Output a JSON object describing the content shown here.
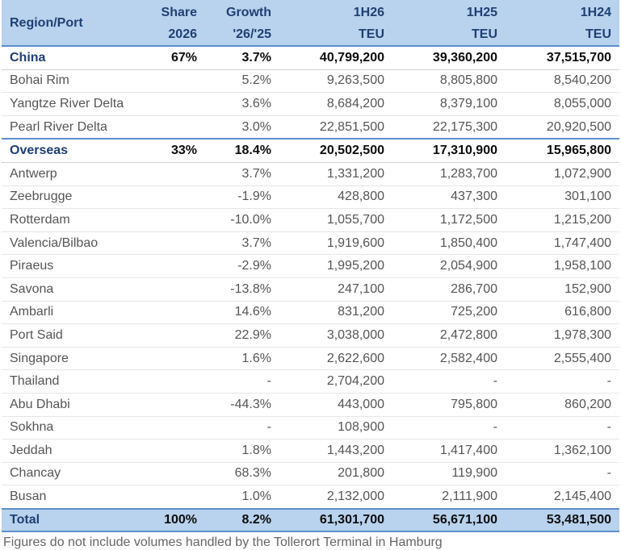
{
  "table": {
    "headers_row1": [
      "Region/Port",
      "Share",
      "Growth",
      "1H26",
      "1H25",
      "1H24"
    ],
    "headers_row2": [
      "",
      "2026",
      "'26/'25",
      "TEU",
      "TEU",
      "TEU"
    ],
    "rows": [
      {
        "kind": "group",
        "cells": [
          "China",
          "67%",
          "3.7%",
          "40,799,200",
          "39,360,200",
          "37,515,700"
        ]
      },
      {
        "kind": "sub",
        "cells": [
          "Bohai Rim",
          "",
          "5.2%",
          "9,263,500",
          "8,805,800",
          "8,540,200"
        ]
      },
      {
        "kind": "sub",
        "cells": [
          "Yangtze River Delta",
          "",
          "3.6%",
          "8,684,200",
          "8,379,100",
          "8,055,000"
        ]
      },
      {
        "kind": "sub",
        "cells": [
          "Pearl River Delta",
          "",
          "3.0%",
          "22,851,500",
          "22,175,300",
          "20,920,500"
        ]
      },
      {
        "kind": "group",
        "cells": [
          "Overseas",
          "33%",
          "18.4%",
          "20,502,500",
          "17,310,900",
          "15,965,800"
        ]
      },
      {
        "kind": "sub",
        "cells": [
          "Antwerp",
          "",
          "3.7%",
          "1,331,200",
          "1,283,700",
          "1,072,900"
        ]
      },
      {
        "kind": "sub",
        "cells": [
          "Zeebrugge",
          "",
          "-1.9%",
          "428,800",
          "437,300",
          "301,100"
        ]
      },
      {
        "kind": "sub",
        "cells": [
          "Rotterdam",
          "",
          "-10.0%",
          "1,055,700",
          "1,172,500",
          "1,215,200"
        ]
      },
      {
        "kind": "sub",
        "cells": [
          "Valencia/Bilbao",
          "",
          "3.7%",
          "1,919,600",
          "1,850,400",
          "1,747,400"
        ]
      },
      {
        "kind": "sub",
        "cells": [
          "Piraeus",
          "",
          "-2.9%",
          "1,995,200",
          "2,054,900",
          "1,958,100"
        ]
      },
      {
        "kind": "sub",
        "cells": [
          "Savona",
          "",
          "-13.8%",
          "247,100",
          "286,700",
          "152,900"
        ]
      },
      {
        "kind": "sub",
        "cells": [
          "Ambarli",
          "",
          "14.6%",
          "831,200",
          "725,200",
          "616,800"
        ]
      },
      {
        "kind": "sub",
        "cells": [
          "Port Said",
          "",
          "22.9%",
          "3,038,000",
          "2,472,800",
          "1,978,300"
        ]
      },
      {
        "kind": "sub",
        "cells": [
          "Singapore",
          "",
          "1.6%",
          "2,622,600",
          "2,582,400",
          "2,555,400"
        ]
      },
      {
        "kind": "sub",
        "cells": [
          "Thailand",
          "",
          "-",
          "2,704,200",
          "-",
          "-"
        ]
      },
      {
        "kind": "sub",
        "cells": [
          "Abu Dhabi",
          "",
          "-44.3%",
          "443,000",
          "795,800",
          "860,200"
        ]
      },
      {
        "kind": "sub",
        "cells": [
          "Sokhna",
          "",
          "-",
          "108,900",
          "-",
          "-"
        ]
      },
      {
        "kind": "sub",
        "cells": [
          "Jeddah",
          "",
          "1.8%",
          "1,443,200",
          "1,417,400",
          "1,362,100"
        ]
      },
      {
        "kind": "sub",
        "cells": [
          "Chancay",
          "",
          "68.3%",
          "201,800",
          "119,900",
          "-"
        ]
      },
      {
        "kind": "sub",
        "cells": [
          "Busan",
          "",
          "1.0%",
          "2,132,000",
          "2,111,900",
          "2,145,400"
        ]
      }
    ],
    "total": [
      "Total",
      "100%",
      "8.2%",
      "61,301,700",
      "56,671,100",
      "53,481,500"
    ]
  },
  "footnote": "Figures do not include volumes handled by the Tollerort Terminal in Hamburg",
  "colors": {
    "header_bg": "#b9d3ee",
    "header_text": "#1f3f73",
    "rule": "#5b8fce"
  }
}
